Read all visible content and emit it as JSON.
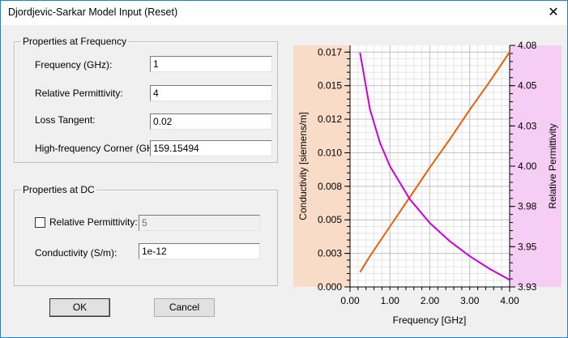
{
  "window": {
    "title": "Djordjevic-Sarkar Model Input (Reset)",
    "close_icon": "close-icon"
  },
  "freq_group": {
    "title": "Properties at Frequency",
    "fields": [
      {
        "label": "Frequency (GHz):",
        "value": "1"
      },
      {
        "label": "Relative Permittivity:",
        "value": "4"
      },
      {
        "label": "Loss Tangent:",
        "value": "0.02"
      },
      {
        "label": "High-frequency Corner (GHz):",
        "value": "159.15494"
      }
    ]
  },
  "dc_group": {
    "title": "Properties at DC",
    "rel_perm": {
      "label": "Relative Permittivity:",
      "value": "5",
      "checked": false,
      "enabled": false
    },
    "conductivity": {
      "label": "Conductivity (S/m):",
      "value": "1e-12"
    }
  },
  "buttons": {
    "ok": "OK",
    "cancel": "Cancel"
  },
  "chart_data": {
    "type": "line",
    "xlabel": "Frequency [GHz]",
    "ylabel_left": "Conductivity [siemens/m]",
    "ylabel_right": "Relative Permittivity",
    "xlim": [
      0,
      4
    ],
    "ylim_left": [
      0,
      0.018
    ],
    "ylim_right": [
      3.925,
      4.075
    ],
    "x_ticks": [
      0,
      1,
      2,
      3,
      4
    ],
    "x_tick_labels": [
      "0.00",
      "1.00",
      "2.00",
      "3.00",
      "4.00"
    ],
    "left_ticks": [
      0,
      0.0025,
      0.005,
      0.0075,
      0.01,
      0.0125,
      0.015,
      0.0175
    ],
    "left_tick_labels": [
      "0.000",
      "0.003",
      "0.005",
      "0.008",
      "0.010",
      "0.012",
      "0.015",
      "0.017"
    ],
    "right_ticks": [
      3.925,
      3.95,
      3.975,
      4.0,
      4.025,
      4.05,
      4.075
    ],
    "right_tick_labels": [
      "3.93",
      "3.95",
      "3.98",
      "4.00",
      "4.03",
      "4.05",
      "4.08"
    ],
    "grid": true,
    "left_axis_color": "#f9dcc8",
    "right_axis_color": "#f5cdf5",
    "x": [
      0.25,
      0.5,
      0.75,
      1,
      1.5,
      2,
      2.5,
      3,
      3.5,
      4
    ],
    "series": [
      {
        "axis": "left",
        "color": "#e8600a",
        "values": [
          0.0011,
          0.0023,
          0.0034,
          0.0045,
          0.0067,
          0.0089,
          0.011,
          0.0132,
          0.0153,
          0.0175
        ]
      },
      {
        "axis": "right",
        "color": "#cc00dd",
        "values": [
          4.0706,
          4.0353,
          4.0146,
          4.0,
          3.9794,
          3.9647,
          3.9534,
          3.9441,
          3.9362,
          3.9294
        ]
      }
    ]
  }
}
